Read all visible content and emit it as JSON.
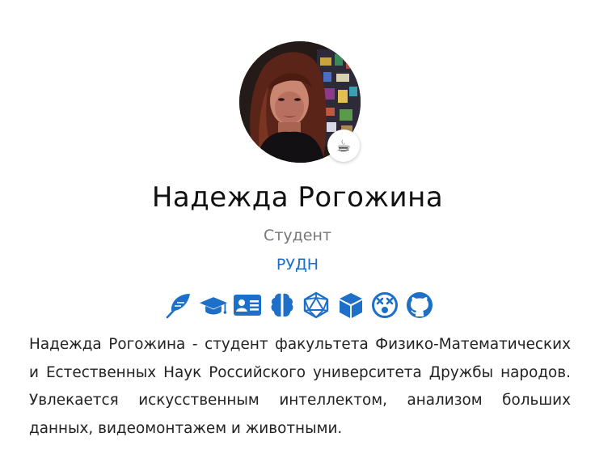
{
  "profile": {
    "avatar_alt": "Надежда Рогожина",
    "status_emoji": "☕",
    "name": "Надежда Рогожина",
    "role": "Студент",
    "organization": "РУДН",
    "bio": "Надежда Рогожина - студент факультета Физико-Математических и Естественных Наук Российского университета Дружбы народов. Увлекается искусственным интеллектом, анализом больших данных, видеомонтажем и животными."
  },
  "social_icons": [
    {
      "name": "feather-icon"
    },
    {
      "name": "graduation-cap-icon"
    },
    {
      "name": "id-card-icon"
    },
    {
      "name": "brain-icon"
    },
    {
      "name": "dice-d20-icon"
    },
    {
      "name": "cube-icon"
    },
    {
      "name": "dizzy-face-icon"
    },
    {
      "name": "github-icon"
    }
  ],
  "colors": {
    "accent": "#1e6fc8",
    "name_text": "#111111",
    "role_text": "#777777",
    "bio_text": "#222222"
  }
}
